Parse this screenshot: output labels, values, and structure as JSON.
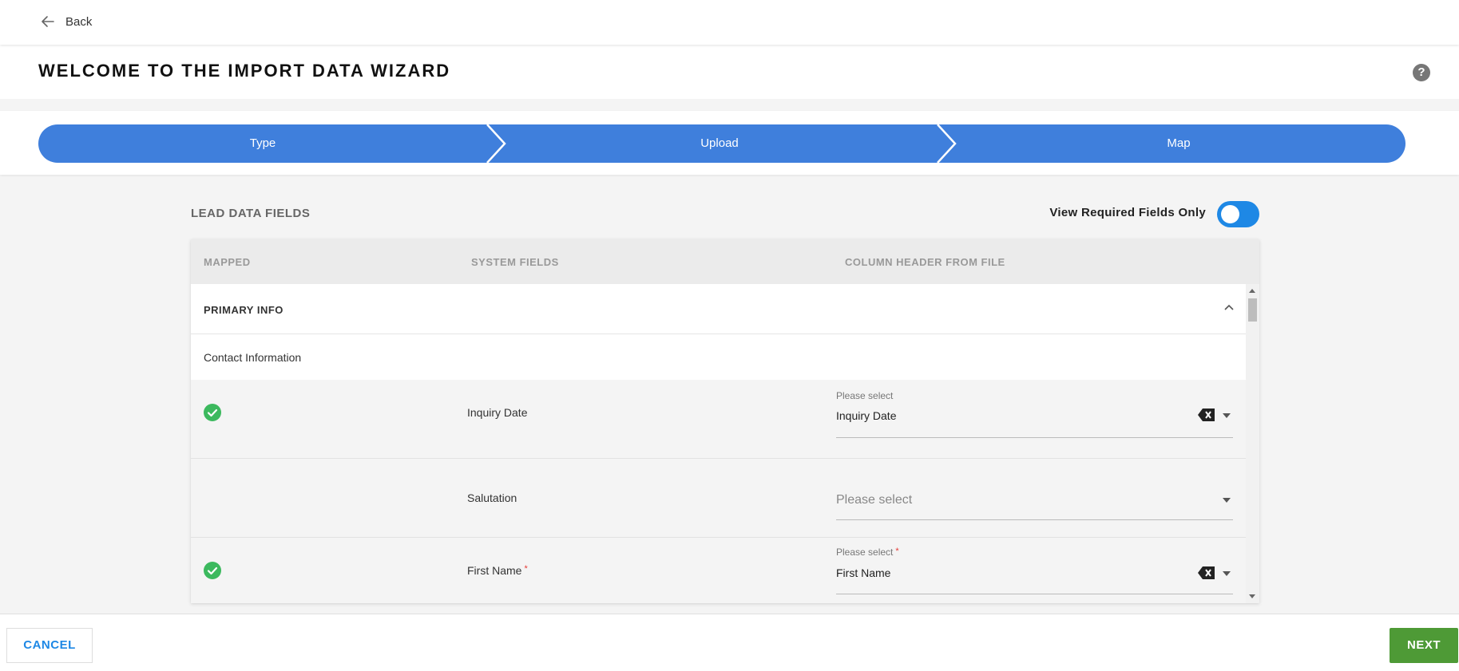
{
  "nav": {
    "back_label": "Back"
  },
  "header": {
    "title": "WELCOME TO THE IMPORT DATA WIZARD",
    "help_glyph": "?"
  },
  "steps": [
    {
      "label": "Type"
    },
    {
      "label": "Upload"
    },
    {
      "label": "Map"
    }
  ],
  "section": {
    "title": "LEAD DATA FIELDS",
    "toggle_label": "View Required Fields Only",
    "toggle_on": true
  },
  "table": {
    "columns": [
      "MAPPED",
      "SYSTEM FIELDS",
      "COLUMN HEADER FROM FILE"
    ],
    "group": "PRIMARY INFO",
    "subgroup": "Contact Information",
    "rows": [
      {
        "mapped": true,
        "field": "Inquiry Date",
        "required": false,
        "select_label": "Please select",
        "select_value": "Inquiry Date"
      },
      {
        "mapped": false,
        "field": "Salutation",
        "required": false,
        "select_placeholder": "Please select"
      },
      {
        "mapped": true,
        "field": "First Name",
        "required": true,
        "select_label": "Please select",
        "select_value": "First Name"
      }
    ],
    "required_marker": "*"
  },
  "footer": {
    "cancel_label": "CANCEL",
    "next_label": "NEXT"
  },
  "colors": {
    "accent": "#1e88e5",
    "step_blue": "#3f7fdc",
    "success": "#3cb95e",
    "next_green": "#4e9a36",
    "required": "#e53935"
  },
  "icons": {
    "back": "arrow-left-icon",
    "help": "help-circle-icon",
    "check": "check-circle-icon",
    "clear": "backspace-icon",
    "collapse": "chevron-up-icon",
    "dropdown": "caret-down-icon"
  }
}
